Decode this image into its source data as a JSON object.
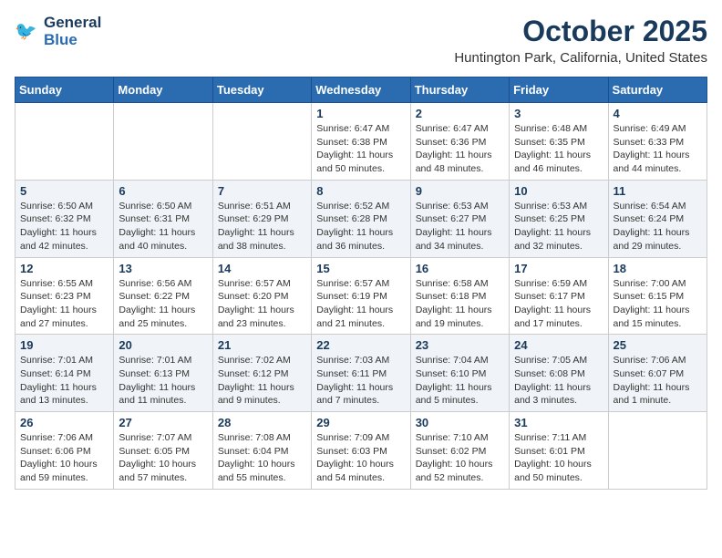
{
  "header": {
    "logo_line1": "General",
    "logo_line2": "Blue",
    "month": "October 2025",
    "location": "Huntington Park, California, United States"
  },
  "weekdays": [
    "Sunday",
    "Monday",
    "Tuesday",
    "Wednesday",
    "Thursday",
    "Friday",
    "Saturday"
  ],
  "weeks": [
    [
      {
        "day": "",
        "info": ""
      },
      {
        "day": "",
        "info": ""
      },
      {
        "day": "",
        "info": ""
      },
      {
        "day": "1",
        "info": "Sunrise: 6:47 AM\nSunset: 6:38 PM\nDaylight: 11 hours\nand 50 minutes."
      },
      {
        "day": "2",
        "info": "Sunrise: 6:47 AM\nSunset: 6:36 PM\nDaylight: 11 hours\nand 48 minutes."
      },
      {
        "day": "3",
        "info": "Sunrise: 6:48 AM\nSunset: 6:35 PM\nDaylight: 11 hours\nand 46 minutes."
      },
      {
        "day": "4",
        "info": "Sunrise: 6:49 AM\nSunset: 6:33 PM\nDaylight: 11 hours\nand 44 minutes."
      }
    ],
    [
      {
        "day": "5",
        "info": "Sunrise: 6:50 AM\nSunset: 6:32 PM\nDaylight: 11 hours\nand 42 minutes."
      },
      {
        "day": "6",
        "info": "Sunrise: 6:50 AM\nSunset: 6:31 PM\nDaylight: 11 hours\nand 40 minutes."
      },
      {
        "day": "7",
        "info": "Sunrise: 6:51 AM\nSunset: 6:29 PM\nDaylight: 11 hours\nand 38 minutes."
      },
      {
        "day": "8",
        "info": "Sunrise: 6:52 AM\nSunset: 6:28 PM\nDaylight: 11 hours\nand 36 minutes."
      },
      {
        "day": "9",
        "info": "Sunrise: 6:53 AM\nSunset: 6:27 PM\nDaylight: 11 hours\nand 34 minutes."
      },
      {
        "day": "10",
        "info": "Sunrise: 6:53 AM\nSunset: 6:25 PM\nDaylight: 11 hours\nand 32 minutes."
      },
      {
        "day": "11",
        "info": "Sunrise: 6:54 AM\nSunset: 6:24 PM\nDaylight: 11 hours\nand 29 minutes."
      }
    ],
    [
      {
        "day": "12",
        "info": "Sunrise: 6:55 AM\nSunset: 6:23 PM\nDaylight: 11 hours\nand 27 minutes."
      },
      {
        "day": "13",
        "info": "Sunrise: 6:56 AM\nSunset: 6:22 PM\nDaylight: 11 hours\nand 25 minutes."
      },
      {
        "day": "14",
        "info": "Sunrise: 6:57 AM\nSunset: 6:20 PM\nDaylight: 11 hours\nand 23 minutes."
      },
      {
        "day": "15",
        "info": "Sunrise: 6:57 AM\nSunset: 6:19 PM\nDaylight: 11 hours\nand 21 minutes."
      },
      {
        "day": "16",
        "info": "Sunrise: 6:58 AM\nSunset: 6:18 PM\nDaylight: 11 hours\nand 19 minutes."
      },
      {
        "day": "17",
        "info": "Sunrise: 6:59 AM\nSunset: 6:17 PM\nDaylight: 11 hours\nand 17 minutes."
      },
      {
        "day": "18",
        "info": "Sunrise: 7:00 AM\nSunset: 6:15 PM\nDaylight: 11 hours\nand 15 minutes."
      }
    ],
    [
      {
        "day": "19",
        "info": "Sunrise: 7:01 AM\nSunset: 6:14 PM\nDaylight: 11 hours\nand 13 minutes."
      },
      {
        "day": "20",
        "info": "Sunrise: 7:01 AM\nSunset: 6:13 PM\nDaylight: 11 hours\nand 11 minutes."
      },
      {
        "day": "21",
        "info": "Sunrise: 7:02 AM\nSunset: 6:12 PM\nDaylight: 11 hours\nand 9 minutes."
      },
      {
        "day": "22",
        "info": "Sunrise: 7:03 AM\nSunset: 6:11 PM\nDaylight: 11 hours\nand 7 minutes."
      },
      {
        "day": "23",
        "info": "Sunrise: 7:04 AM\nSunset: 6:10 PM\nDaylight: 11 hours\nand 5 minutes."
      },
      {
        "day": "24",
        "info": "Sunrise: 7:05 AM\nSunset: 6:08 PM\nDaylight: 11 hours\nand 3 minutes."
      },
      {
        "day": "25",
        "info": "Sunrise: 7:06 AM\nSunset: 6:07 PM\nDaylight: 11 hours\nand 1 minute."
      }
    ],
    [
      {
        "day": "26",
        "info": "Sunrise: 7:06 AM\nSunset: 6:06 PM\nDaylight: 10 hours\nand 59 minutes."
      },
      {
        "day": "27",
        "info": "Sunrise: 7:07 AM\nSunset: 6:05 PM\nDaylight: 10 hours\nand 57 minutes."
      },
      {
        "day": "28",
        "info": "Sunrise: 7:08 AM\nSunset: 6:04 PM\nDaylight: 10 hours\nand 55 minutes."
      },
      {
        "day": "29",
        "info": "Sunrise: 7:09 AM\nSunset: 6:03 PM\nDaylight: 10 hours\nand 54 minutes."
      },
      {
        "day": "30",
        "info": "Sunrise: 7:10 AM\nSunset: 6:02 PM\nDaylight: 10 hours\nand 52 minutes."
      },
      {
        "day": "31",
        "info": "Sunrise: 7:11 AM\nSunset: 6:01 PM\nDaylight: 10 hours\nand 50 minutes."
      },
      {
        "day": "",
        "info": ""
      }
    ]
  ]
}
